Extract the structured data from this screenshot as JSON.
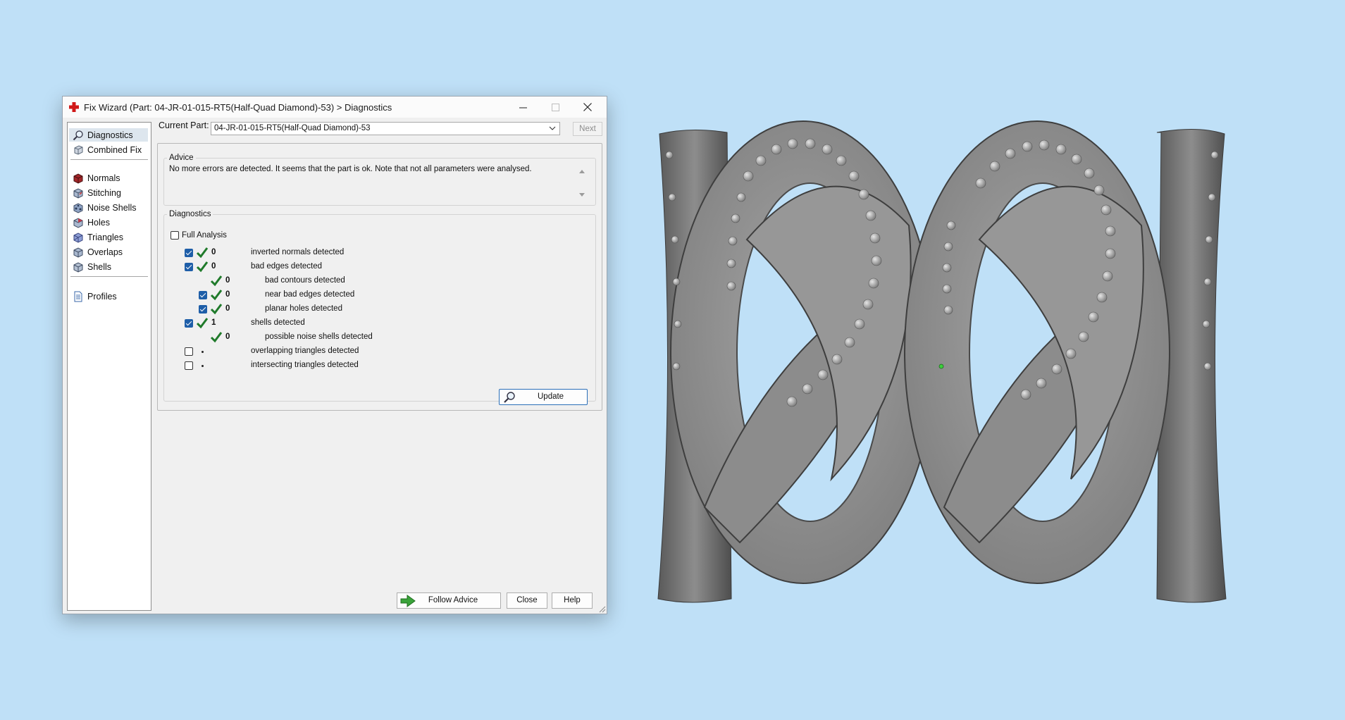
{
  "window": {
    "title": "Fix Wizard (Part: 04-JR-01-015-RT5(Half-Quad Diamond)-53) > Diagnostics"
  },
  "nav": {
    "items": [
      {
        "label": "Diagnostics",
        "icon": "magnifier-icon",
        "selected": true
      },
      {
        "label": "Combined Fix",
        "icon": "cube-icon"
      },
      {
        "label": "Normals",
        "icon": "normals-cube-icon"
      },
      {
        "label": "Stitching",
        "icon": "stitching-cube-icon"
      },
      {
        "label": "Noise Shells",
        "icon": "noise-shells-cube-icon"
      },
      {
        "label": "Holes",
        "icon": "holes-cube-icon"
      },
      {
        "label": "Triangles",
        "icon": "triangles-cube-icon"
      },
      {
        "label": "Overlaps",
        "icon": "overlaps-cube-icon"
      },
      {
        "label": "Shells",
        "icon": "shells-cube-icon"
      },
      {
        "label": "Profiles",
        "icon": "document-icon"
      }
    ]
  },
  "current_part": {
    "label": "Current Part:",
    "value": "04-JR-01-015-RT5(Half-Quad Diamond)-53",
    "next_label": "Next"
  },
  "advice": {
    "legend": "Advice",
    "text": "No more errors are detected. It seems that the part is ok. Note that not all parameters were analysed."
  },
  "diagnostics": {
    "legend": "Diagnostics",
    "full_analysis_label": "Full Analysis",
    "full_analysis_checked": false,
    "rows": [
      {
        "checked": true,
        "status": "ok",
        "count": "0",
        "label": "inverted normals detected",
        "level": 0
      },
      {
        "checked": true,
        "status": "ok",
        "count": "0",
        "label": "bad edges detected",
        "level": 0
      },
      {
        "checked": null,
        "status": "ok",
        "count": "0",
        "label": "bad contours detected",
        "level": 1
      },
      {
        "checked": true,
        "status": "ok",
        "count": "0",
        "label": "near bad edges detected",
        "level": 1
      },
      {
        "checked": true,
        "status": "ok",
        "count": "0",
        "label": "planar holes detected",
        "level": 1
      },
      {
        "checked": true,
        "status": "ok",
        "count": "1",
        "label": "shells detected",
        "level": 0
      },
      {
        "checked": null,
        "status": "ok",
        "count": "0",
        "label": "possible noise shells detected",
        "level": 1
      },
      {
        "checked": false,
        "status": "none",
        "count": "",
        "label": "overlapping triangles detected",
        "level": 0
      },
      {
        "checked": false,
        "status": "none",
        "count": "",
        "label": "intersecting triangles detected",
        "level": 0
      }
    ],
    "update_label": "Update"
  },
  "footer": {
    "follow_advice_label": "Follow Advice",
    "close_label": "Close",
    "help_label": "Help"
  },
  "colors": {
    "background": "#bfe0f7",
    "check_green": "#1f7a2a",
    "checkbox_blue": "#1e5ea8",
    "model_grey": "#9a9a9a"
  }
}
